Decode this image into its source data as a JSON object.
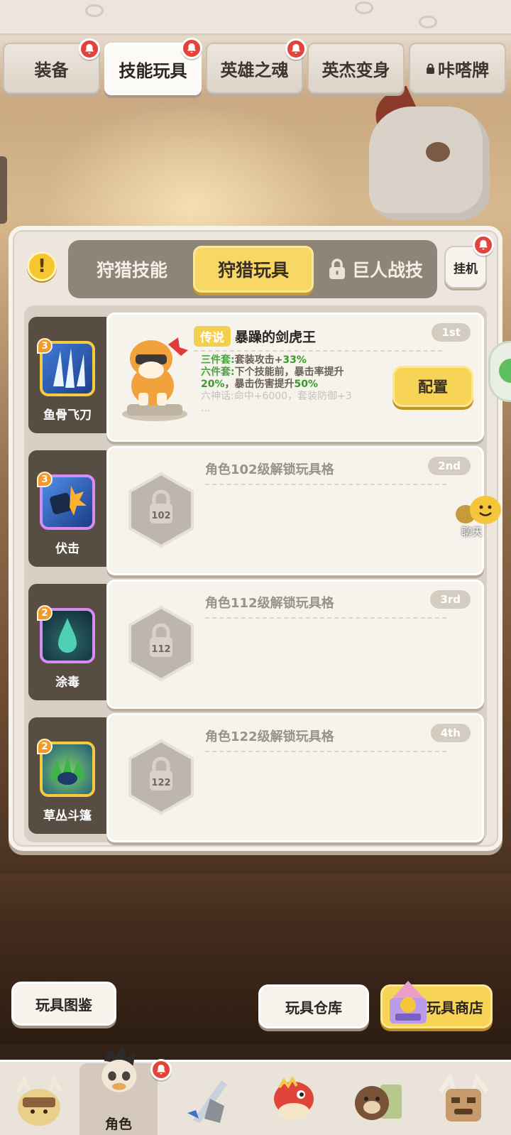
{
  "top_tabs": [
    {
      "label": "装备",
      "badge": true
    },
    {
      "label": "技能玩具",
      "badge": true,
      "active": true
    },
    {
      "label": "英雄之魂",
      "badge": true
    },
    {
      "label": "英杰变身",
      "badge": false
    },
    {
      "label": "咔嗒牌",
      "badge": false,
      "locked": true
    }
  ],
  "sub_tabs": [
    {
      "label": "狩猎技能"
    },
    {
      "label": "狩猎玩具",
      "active": true
    },
    {
      "label": "巨人战技",
      "locked": true
    }
  ],
  "idle_button": "挂机",
  "info_button": "!",
  "slots": [
    {
      "skill": {
        "name": "鱼骨飞刀",
        "level": "3"
      },
      "rank": "1st",
      "toy": {
        "rarity": "传说",
        "name": "暴躁的剑虎王",
        "line1_label": "三件套:",
        "line1_text": "套装攻击+",
        "line1_value": "33%",
        "line2_label": "六件套:",
        "line2_text": "下个技能前，暴击率提升",
        "line3_value_a": "20%",
        "line3_text": "，暴击伤害提升",
        "line3_value_b": "50%",
        "line4": "六神话:命中+6000，套装防御+3",
        "line5": "..."
      },
      "config_button": "配置"
    },
    {
      "skill": {
        "name": "伏击",
        "level": "3"
      },
      "rank": "2nd",
      "unlock_text": "角色102级解锁玩具格",
      "lock_level": "102"
    },
    {
      "skill": {
        "name": "涂毒",
        "level": "2"
      },
      "rank": "3rd",
      "unlock_text": "角色112级解锁玩具格",
      "lock_level": "112"
    },
    {
      "skill": {
        "name": "草丛斗篷",
        "level": "2"
      },
      "rank": "4th",
      "unlock_text": "角色122级解锁玩具格",
      "lock_level": "122"
    }
  ],
  "chat_label": "聊天",
  "buttons": {
    "codex": "玩具图鉴",
    "warehouse": "玩具仓库",
    "shop": "玩具商店"
  },
  "nav": [
    {
      "label": "",
      "icon": "barbarian-hero-icon"
    },
    {
      "label": "角色",
      "icon": "skull-mask-hero-icon",
      "active": true,
      "badge": true
    },
    {
      "label": "",
      "icon": "sword-shield-icon"
    },
    {
      "label": "",
      "icon": "dino-pet-icon"
    },
    {
      "label": "",
      "icon": "bear-shop-icon"
    },
    {
      "label": "",
      "icon": "tiki-totem-icon"
    }
  ],
  "colors": {
    "accent_yellow": "#f7d456",
    "badge_red": "#e2433a",
    "bonus_green": "#3a9a2c",
    "panel_bg": "#ece6de",
    "skill_col": "#574d43"
  }
}
